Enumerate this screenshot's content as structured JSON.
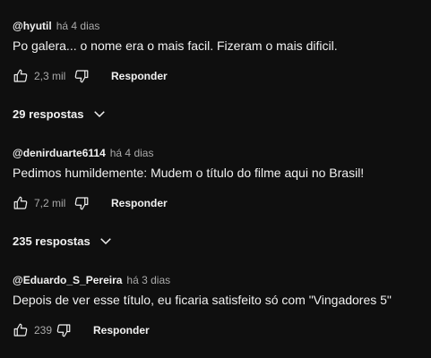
{
  "comments": [
    {
      "author": "@hyutil",
      "time": "há 4 dias",
      "text": "Po galera... o nome era o mais facil. Fizeram o mais dificil.",
      "likes": "2,3 mil",
      "reply_label": "Responder",
      "replies_label": "29 respostas"
    },
    {
      "author": "@denirduarte6114",
      "time": "há 4 dias",
      "text": "Pedimos humildemente: Mudem o título do filme aqui no Brasil!",
      "likes": "7,2 mil",
      "reply_label": "Responder",
      "replies_label": "235 respostas"
    },
    {
      "author": "@Eduardo_S_Pereira",
      "time": "há 3 dias",
      "text": "Depois de ver esse título, eu ficaria satisfeito só com \"Vingadores 5\"",
      "likes": "239",
      "reply_label": "Responder"
    }
  ],
  "icons": {
    "like": "thumbs-up-icon",
    "dislike": "thumbs-down-icon",
    "expand": "chevron-down-icon"
  }
}
